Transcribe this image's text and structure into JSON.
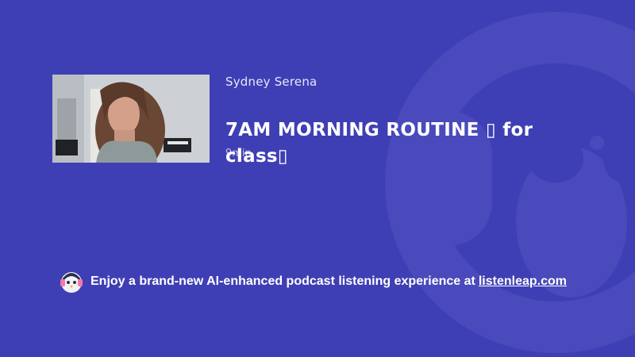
{
  "colors": {
    "background": "#3f3fb5",
    "watermark": "#4b4bbd"
  },
  "video": {
    "channel": "Sydney Serena",
    "title": "7AM MORNING ROUTINE ▯ for class▯",
    "duration": "9min",
    "thumbnail_icon": "video-thumbnail-image"
  },
  "footer": {
    "icon": "penguin-headphones-icon",
    "message": "Enjoy a brand-new AI-enhanced podcast listening experience at",
    "link_text": "listenleap.com"
  }
}
